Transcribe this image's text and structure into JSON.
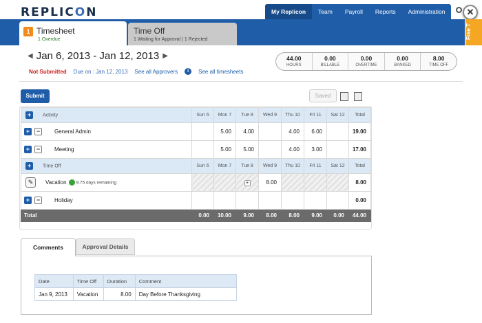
{
  "brand": {
    "logo_left": "REPLIC",
    "logo_o": "O",
    "logo_right": "N"
  },
  "nav": [
    {
      "label": "My Replicon",
      "active": true
    },
    {
      "label": "Team"
    },
    {
      "label": "Payroll"
    },
    {
      "label": "Reports"
    },
    {
      "label": "Administration"
    }
  ],
  "close_glyph": "✕",
  "free_trial": "Free T",
  "tabs": {
    "timesheet": {
      "badge": "1",
      "title": "Timesheet",
      "sub": "1 Overdue"
    },
    "timeoff": {
      "title": "Time Off",
      "sub": "1 Waiting for Approval | 1 Rejected"
    }
  },
  "period": {
    "prev": "◀",
    "range": "Jan 6, 2013 - Jan 12, 2013",
    "next": "▶"
  },
  "status": {
    "state": "Not Submitted",
    "due": "Due on : Jan 12, 2013",
    "approvers": "See all Approvers",
    "info": "i",
    "all_timesheets": "See all timesheets"
  },
  "summary": [
    {
      "value": "44.00",
      "label": "HOURS"
    },
    {
      "value": "0.00",
      "label": "BILLABLE"
    },
    {
      "value": "0.00",
      "label": "OVERTIME"
    },
    {
      "value": "0.00",
      "label": "BANKED"
    },
    {
      "value": "8.00",
      "label": "TIME OFF"
    }
  ],
  "toolbar": {
    "submit": "Submit",
    "saved": "Saved"
  },
  "grid": {
    "activity_header": "Activity",
    "timeoff_header": "Time Off",
    "days": [
      "Sun 6",
      "Mon 7",
      "Tue 8",
      "Wed 9",
      "Thu 10",
      "Fri 11",
      "Sat 12"
    ],
    "total_header": "Total",
    "rows": [
      {
        "name": "General Admin",
        "cells": [
          "",
          "5.00",
          "4.00",
          "",
          "4.00",
          "6.00",
          ""
        ],
        "total": "19.00"
      },
      {
        "name": "Meeting",
        "cells": [
          "",
          "5.00",
          "5.00",
          "",
          "4.00",
          "3.00",
          ""
        ],
        "total": "17.00"
      }
    ],
    "timeoff_rows": [
      {
        "name": "Vacation",
        "remaining": "9.75 days remaining",
        "cells": [
          "",
          "",
          "+",
          "8.00",
          "",
          "",
          ""
        ],
        "total": "8.00"
      },
      {
        "name": "Holiday",
        "cells": [
          "",
          "",
          "",
          "",
          "",
          "",
          ""
        ],
        "total": "0.00"
      }
    ],
    "total_row": {
      "label": "Total",
      "cells": [
        "0.00",
        "10.00",
        "9.00",
        "8.00",
        "8.00",
        "9.00",
        "0.00"
      ],
      "total": "44.00"
    }
  },
  "comments": {
    "tab_active": "Comments",
    "tab_other": "Approval Details",
    "headers": [
      "Date",
      "Time Off",
      "Duration",
      "Comment"
    ],
    "rows": [
      {
        "date": "Jan 9, 2013",
        "type": "Vacation",
        "duration": "8.00",
        "comment": "Day Before Thanksgiving"
      }
    ]
  }
}
